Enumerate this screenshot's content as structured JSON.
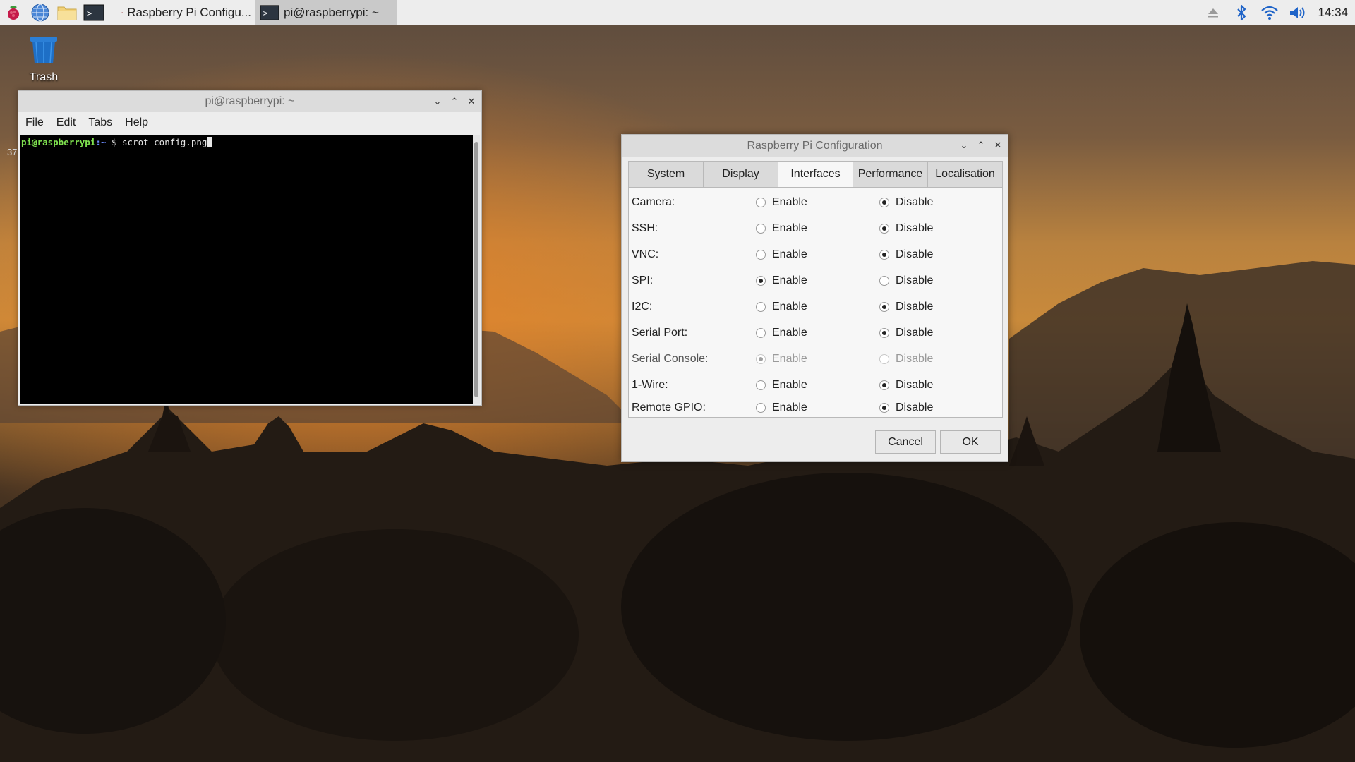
{
  "taskbar": {
    "tasks": [
      {
        "label": "Raspberry Pi Configu..."
      },
      {
        "label": "pi@raspberrypi: ~"
      }
    ],
    "clock": "14:34"
  },
  "desktop": {
    "trash_label": "Trash",
    "stray_text": "37"
  },
  "terminal": {
    "title": "pi@raspberrypi: ~",
    "menu": [
      "File",
      "Edit",
      "Tabs",
      "Help"
    ],
    "prompt_user": "pi@raspberrypi",
    "prompt_path": ":~",
    "prompt_symbol": " $ ",
    "command": "scrot config.png"
  },
  "config": {
    "title": "Raspberry Pi Configuration",
    "tabs": [
      "System",
      "Display",
      "Interfaces",
      "Performance",
      "Localisation"
    ],
    "active_tab": "Interfaces",
    "enable_label": "Enable",
    "disable_label": "Disable",
    "rows": [
      {
        "label": "Camera:",
        "value": "Disable",
        "disabled": false
      },
      {
        "label": "SSH:",
        "value": "Disable",
        "disabled": false
      },
      {
        "label": "VNC:",
        "value": "Disable",
        "disabled": false
      },
      {
        "label": "SPI:",
        "value": "Enable",
        "disabled": false
      },
      {
        "label": "I2C:",
        "value": "Disable",
        "disabled": false
      },
      {
        "label": "Serial Port:",
        "value": "Disable",
        "disabled": false
      },
      {
        "label": "Serial Console:",
        "value": "Enable",
        "disabled": true
      },
      {
        "label": "1-Wire:",
        "value": "Disable",
        "disabled": false
      },
      {
        "label": "Remote GPIO:",
        "value": "Disable",
        "disabled": false
      }
    ],
    "cancel_label": "Cancel",
    "ok_label": "OK"
  },
  "colors": {
    "taskbar_bg": "#ededed",
    "window_bg": "#ededed",
    "terminal_bg": "#000000",
    "prompt_green": "#7fe24f",
    "prompt_blue": "#6c8cff"
  }
}
